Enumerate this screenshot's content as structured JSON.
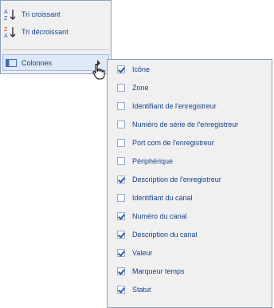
{
  "menu": {
    "sort_asc": "Tri croissant",
    "sort_desc": "Tri décroissant",
    "columns": "Colonnes"
  },
  "columns": [
    {
      "label": "Icône",
      "checked": true
    },
    {
      "label": "Zone",
      "checked": false
    },
    {
      "label": "Identifiant de l'enregistreur",
      "checked": false
    },
    {
      "label": "Numéro de série de l'enregistreur",
      "checked": false
    },
    {
      "label": "Port com de l'enregistreur",
      "checked": false
    },
    {
      "label": "Périphérique",
      "checked": false
    },
    {
      "label": "Description de l'enregistreur",
      "checked": true
    },
    {
      "label": "Identifiant du canal",
      "checked": false
    },
    {
      "label": "Numéro du canal",
      "checked": true
    },
    {
      "label": "Description du canal",
      "checked": true
    },
    {
      "label": "Valeur",
      "checked": true
    },
    {
      "label": "Marqueur temps",
      "checked": true
    },
    {
      "label": "Statut",
      "checked": true
    }
  ],
  "colors": {
    "menu_bg": "#f0f0f0",
    "border": "#8ba0bc",
    "text": "#15428b",
    "active_bg": "#dfe8f6"
  }
}
